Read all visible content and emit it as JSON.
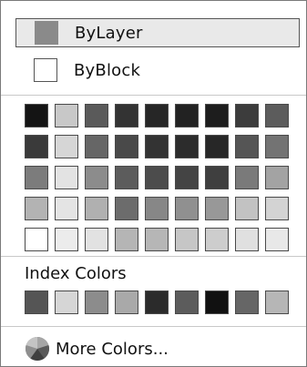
{
  "top_items": [
    {
      "label": "ByLayer",
      "swatch_color": "#8a8a8a",
      "selected": true
    },
    {
      "label": "ByBlock",
      "swatch_color": "#ffffff",
      "selected": false
    }
  ],
  "palette_colors": [
    [
      "#141414",
      "#c8c8c8",
      "#5a5a5a",
      "#333333",
      "#262626",
      "#222222",
      "#1d1d1d",
      "#3c3c3c",
      "#5c5c5c"
    ],
    [
      "#3a3a3a",
      "#d6d6d6",
      "#666666",
      "#494949",
      "#333333",
      "#2c2c2c",
      "#272727",
      "#555555",
      "#737373"
    ],
    [
      "#7c7c7c",
      "#e3e3e3",
      "#8c8c8c",
      "#5c5c5c",
      "#4c4c4c",
      "#444444",
      "#3f3f3f",
      "#7a7a7a",
      "#a3a3a3"
    ],
    [
      "#b3b3b3",
      "#e4e4e4",
      "#b0b0b0",
      "#6c6c6c",
      "#878787",
      "#909090",
      "#989898",
      "#c2c2c2",
      "#d3d3d3"
    ],
    [
      "#ffffff",
      "#ececec",
      "#e2e2e2",
      "#b5b5b5",
      "#b6b6b6",
      "#c6c6c6",
      "#cdcdcd",
      "#e0e0e0",
      "#e8e8e8"
    ]
  ],
  "index_section": {
    "title": "Index Colors",
    "colors": [
      "#555555",
      "#d6d6d6",
      "#8c8c8c",
      "#a9a9a9",
      "#2b2b2b",
      "#5c5c5c",
      "#111111",
      "#666666",
      "#b6b6b6"
    ]
  },
  "more_colors": {
    "label": "More Colors...",
    "icon": "color-wheel-icon"
  }
}
